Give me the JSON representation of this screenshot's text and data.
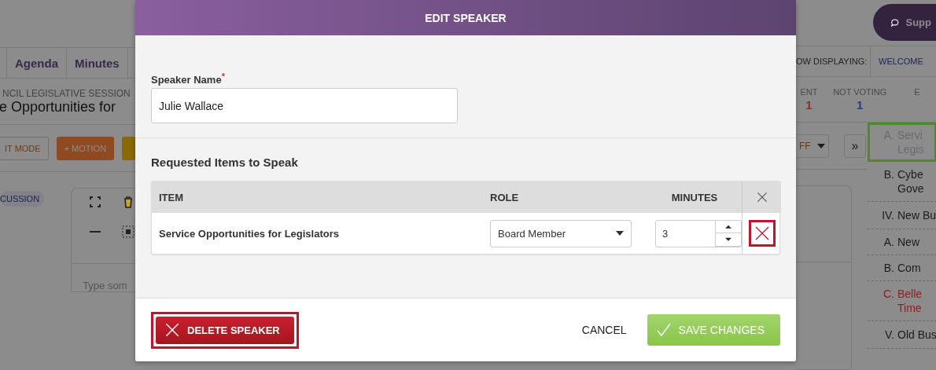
{
  "background": {
    "tabs": [
      {
        "label": "Agenda"
      },
      {
        "label": "Minutes"
      }
    ],
    "meeting_type": "NCIL LEGISLATIVE SESSION",
    "item_title": "e Opportunities for",
    "toolbar_buttons": [
      {
        "label": "IT MODE",
        "kind": "outline"
      },
      {
        "label": "+ MOTION",
        "kind": "orange"
      },
      {
        "kind": "yellow"
      }
    ],
    "status_chip": "CUSSION",
    "editor": {
      "placeholder": "Type som"
    },
    "support_button": "Supp",
    "now_displaying": {
      "label": "OW DISPLAYING:",
      "value": "WELCOME"
    },
    "vote_counts": [
      {
        "label": "ENT",
        "value": "1",
        "color": "#962828"
      },
      {
        "label": "NOT VOTING",
        "value": "1",
        "color": "#2a3a8a"
      },
      {
        "label": "E"
      }
    ],
    "dropdown": "FF",
    "expand_button": "»",
    "agenda": {
      "continued_items": [
        {
          "marker": "A.",
          "lines": [
            "Servi",
            "Legis"
          ],
          "selected": true,
          "color": "#6a6a6a"
        },
        {
          "marker": "B.",
          "lines": [
            "Cybe",
            "Gove"
          ],
          "selected": false,
          "color": "#1c1c1c"
        }
      ],
      "sections": [
        {
          "marker": "IV.",
          "title": "New Bu",
          "children": [
            {
              "marker": "A.",
              "lines": [
                "New"
              ],
              "selected": false,
              "color": "#1c1c1c"
            },
            {
              "marker": "B.",
              "lines": [
                "Com"
              ],
              "selected": false,
              "color": "#1c1c1c"
            },
            {
              "marker": "C.",
              "lines": [
                "Belle",
                "Time"
              ],
              "selected": false,
              "color": "#8c2020"
            }
          ]
        },
        {
          "marker": "V.",
          "title": "Old Bus"
        }
      ]
    }
  },
  "dialog": {
    "title": "EDIT SPEAKER",
    "speaker_name": {
      "label": "Speaker Name",
      "required_mark": "*",
      "value": "Julie Wallace"
    },
    "section_title": "Requested Items to Speak",
    "table": {
      "columns": [
        "ITEM",
        "ROLE",
        "MINUTES"
      ],
      "rows": [
        {
          "item": "Service Opportunities for Legislators",
          "role": "Board Member",
          "minutes": "3",
          "remove_highlighted": true
        }
      ]
    },
    "buttons": [
      {
        "label": "DELETE SPEAKER",
        "kind": "delete",
        "highlighted": true
      },
      {
        "label": "CANCEL",
        "kind": "text"
      },
      {
        "label": "SAVE CHANGES",
        "kind": "save"
      }
    ]
  }
}
